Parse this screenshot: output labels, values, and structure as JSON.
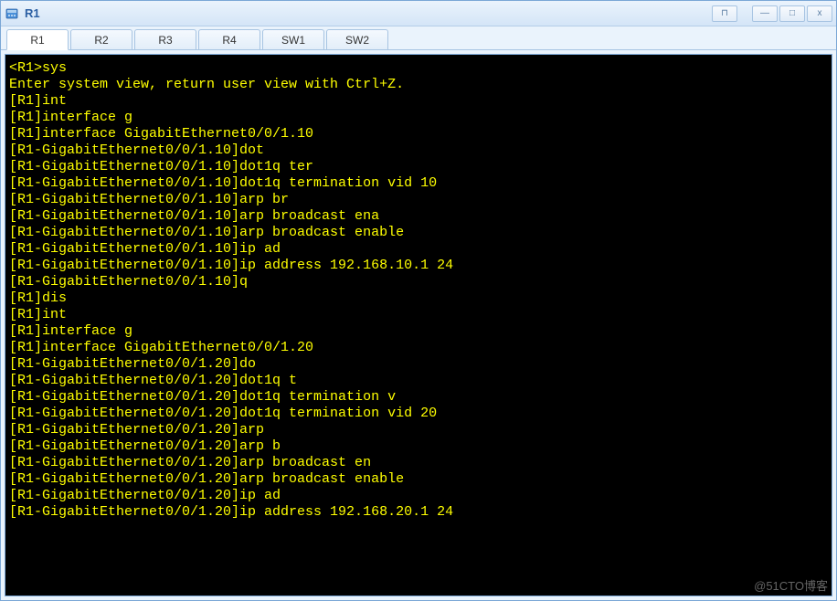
{
  "window": {
    "title": "R1"
  },
  "controls": {
    "detach": "⊓",
    "minimize": "—",
    "maximize": "□",
    "close": "x"
  },
  "tabs": [
    {
      "label": "R1",
      "active": true
    },
    {
      "label": "R2",
      "active": false
    },
    {
      "label": "R3",
      "active": false
    },
    {
      "label": "R4",
      "active": false
    },
    {
      "label": "SW1",
      "active": false
    },
    {
      "label": "SW2",
      "active": false
    }
  ],
  "terminal": {
    "lines": [
      "",
      "<R1>sys",
      "Enter system view, return user view with Ctrl+Z.",
      "[R1]int",
      "[R1]interface g",
      "[R1]interface GigabitEthernet0/0/1.10",
      "[R1-GigabitEthernet0/0/1.10]dot",
      "[R1-GigabitEthernet0/0/1.10]dot1q ter",
      "[R1-GigabitEthernet0/0/1.10]dot1q termination vid 10",
      "[R1-GigabitEthernet0/0/1.10]arp br",
      "[R1-GigabitEthernet0/0/1.10]arp broadcast ena",
      "[R1-GigabitEthernet0/0/1.10]arp broadcast enable",
      "[R1-GigabitEthernet0/0/1.10]ip ad",
      "[R1-GigabitEthernet0/0/1.10]ip address 192.168.10.1 24",
      "[R1-GigabitEthernet0/0/1.10]q",
      "[R1]dis",
      "[R1]int",
      "[R1]interface g",
      "[R1]interface GigabitEthernet0/0/1.20",
      "[R1-GigabitEthernet0/0/1.20]do",
      "[R1-GigabitEthernet0/0/1.20]dot1q t",
      "[R1-GigabitEthernet0/0/1.20]dot1q termination v",
      "[R1-GigabitEthernet0/0/1.20]dot1q termination vid 20",
      "[R1-GigabitEthernet0/0/1.20]arp",
      "[R1-GigabitEthernet0/0/1.20]arp b",
      "[R1-GigabitEthernet0/0/1.20]arp broadcast en",
      "[R1-GigabitEthernet0/0/1.20]arp broadcast enable",
      "[R1-GigabitEthernet0/0/1.20]ip ad",
      "[R1-GigabitEthernet0/0/1.20]ip address 192.168.20.1 24"
    ]
  },
  "watermark": "@51CTO博客"
}
